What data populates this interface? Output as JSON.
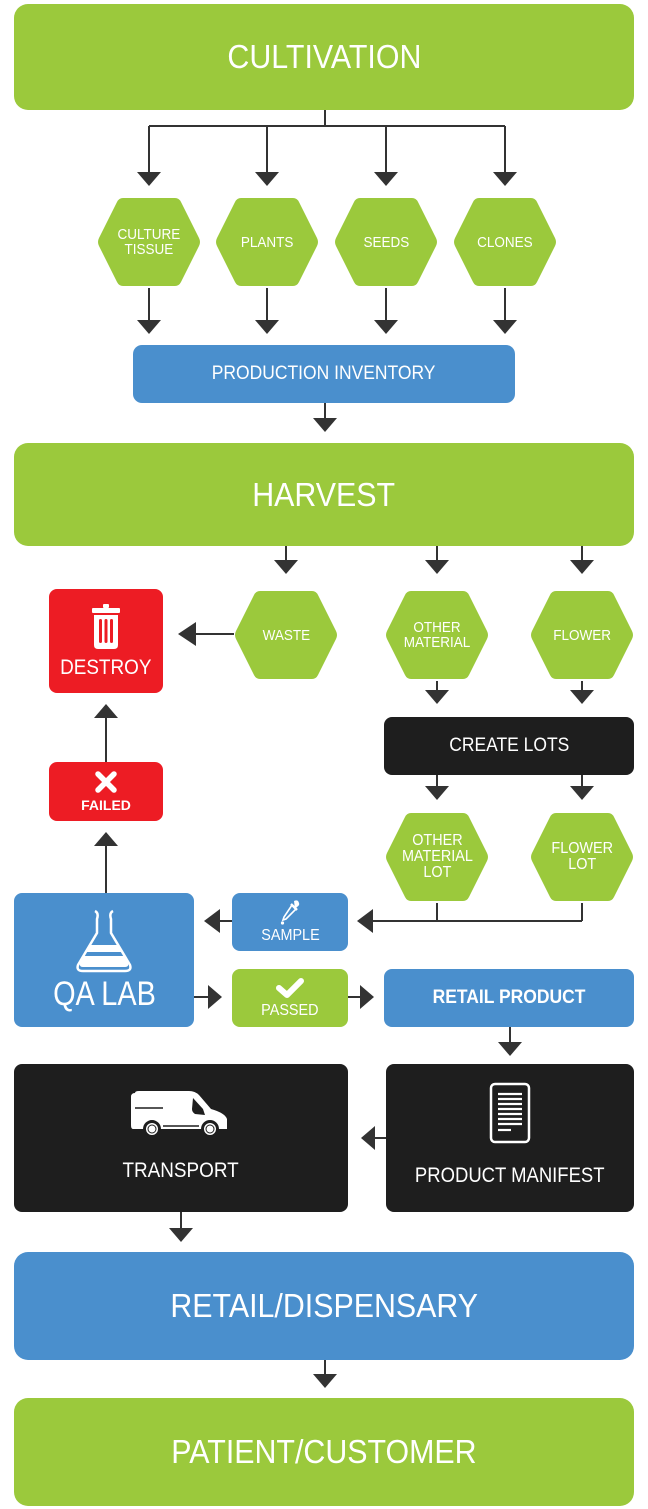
{
  "colors": {
    "green": "#9BC93C",
    "blue": "#4A8FCD",
    "red": "#ED1C24",
    "black": "#1E1E1E",
    "arrow": "#333333",
    "text": "#FFFFFF"
  },
  "stages": {
    "cultivation": "CULTIVATION",
    "harvest": "HARVEST",
    "retail_dispensary": "RETAIL/DISPENSARY",
    "patient_customer": "PATIENT/CUSTOMER"
  },
  "cultivation_sources": [
    {
      "label": "CULTURE\nTISSUE"
    },
    {
      "label": "PLANTS"
    },
    {
      "label": "SEEDS"
    },
    {
      "label": "CLONES"
    }
  ],
  "production_inventory": "PRODUCTION INVENTORY",
  "harvest_outputs": [
    {
      "label": "WASTE"
    },
    {
      "label": "OTHER\nMATERIAL"
    },
    {
      "label": "FLOWER"
    }
  ],
  "destroy": {
    "label": "DESTROY",
    "icon": "trash-icon"
  },
  "failed": {
    "label": "FAILED",
    "icon": "x-icon"
  },
  "create_lots": "CREATE LOTS",
  "lots": [
    {
      "label": "OTHER\nMATERIAL\nLOT"
    },
    {
      "label": "FLOWER\nLOT"
    }
  ],
  "qa_lab": {
    "label": "QA LAB",
    "icon": "flask-icon"
  },
  "sample": {
    "label": "SAMPLE",
    "icon": "dropper-icon"
  },
  "passed": {
    "label": "PASSED",
    "icon": "checkmark-icon"
  },
  "retail_product": "RETAIL PRODUCT",
  "transport": {
    "label": "TRANSPORT",
    "icon": "van-icon"
  },
  "product_manifest": {
    "label": "PRODUCT MANIFEST",
    "icon": "document-icon"
  }
}
